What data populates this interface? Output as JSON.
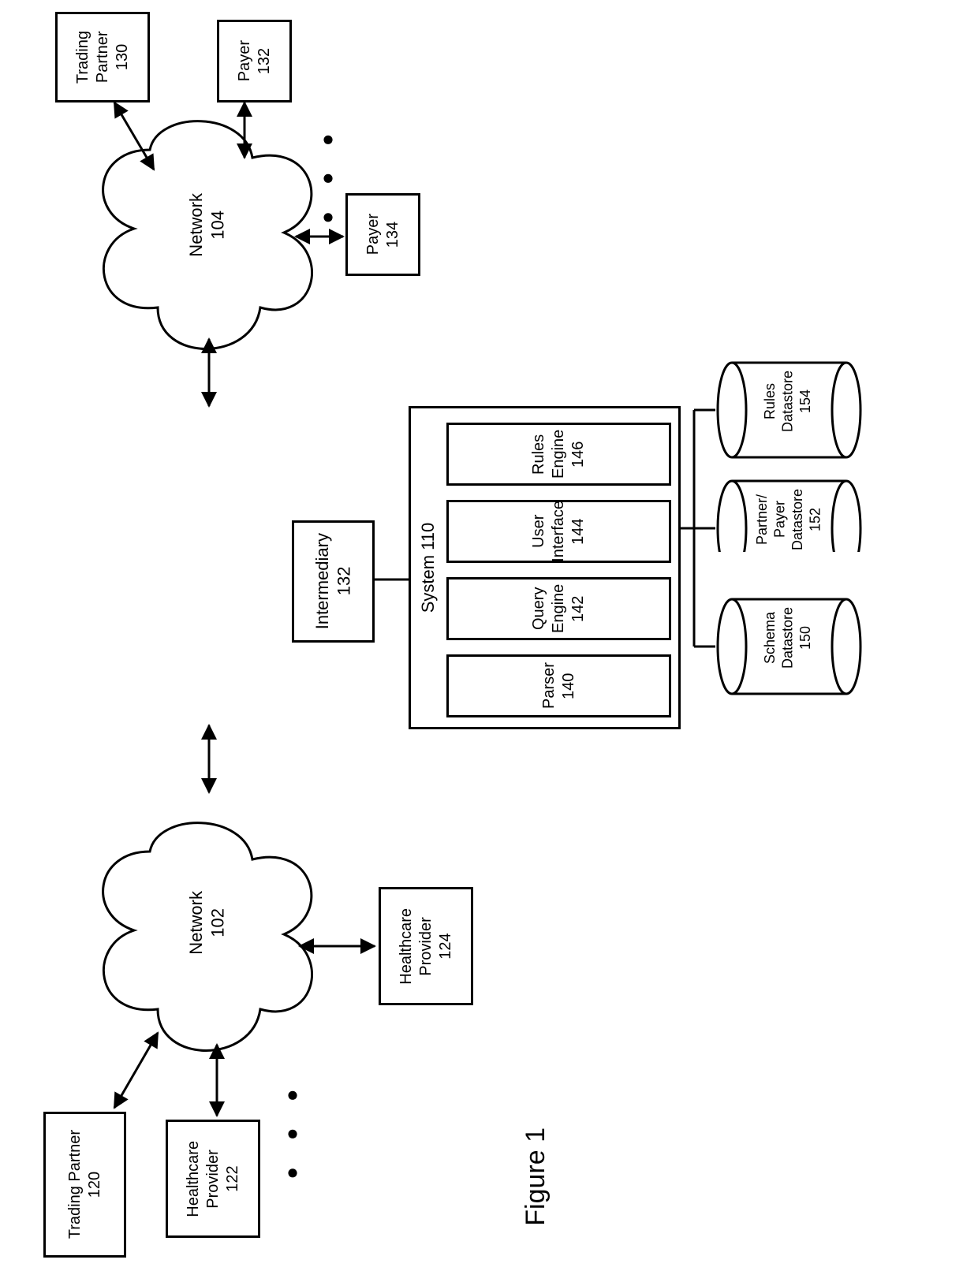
{
  "figure_caption": "Figure 1",
  "nodes": {
    "intermediary": {
      "lines": [
        "Intermediary",
        "132"
      ]
    },
    "system": {
      "title": "System 110"
    },
    "parser": {
      "lines": [
        "Parser 140"
      ]
    },
    "query_engine": {
      "lines": [
        "Query Engine",
        "142"
      ]
    },
    "user_interface": {
      "lines": [
        "User Interface",
        "144"
      ]
    },
    "rules_engine": {
      "lines": [
        "Rules Engine",
        "146"
      ]
    },
    "trading_partner_120": {
      "lines": [
        "Trading Partner",
        "120"
      ]
    },
    "healthcare_122": {
      "lines": [
        "Healthcare",
        "Provider",
        "122"
      ]
    },
    "healthcare_124": {
      "lines": [
        "Healthcare",
        "Provider",
        "124"
      ]
    },
    "trading_partner_130": {
      "lines": [
        "Trading",
        "Partner",
        "130"
      ]
    },
    "payer_132": {
      "lines": [
        "Payer",
        "132"
      ]
    },
    "payer_134": {
      "lines": [
        "Payer",
        "134"
      ]
    },
    "network_102": {
      "lines": [
        "Network",
        "102"
      ]
    },
    "network_104": {
      "lines": [
        "Network",
        "104"
      ]
    },
    "schema_ds": {
      "lines": [
        "Schema",
        "Datastore",
        "150"
      ]
    },
    "partner_payer_ds": {
      "lines": [
        "Partner/",
        "Payer",
        "Datastore",
        "152"
      ]
    },
    "rules_ds": {
      "lines": [
        "Rules",
        "Datastore",
        "154"
      ]
    }
  },
  "ellipsis": "● ● ●"
}
